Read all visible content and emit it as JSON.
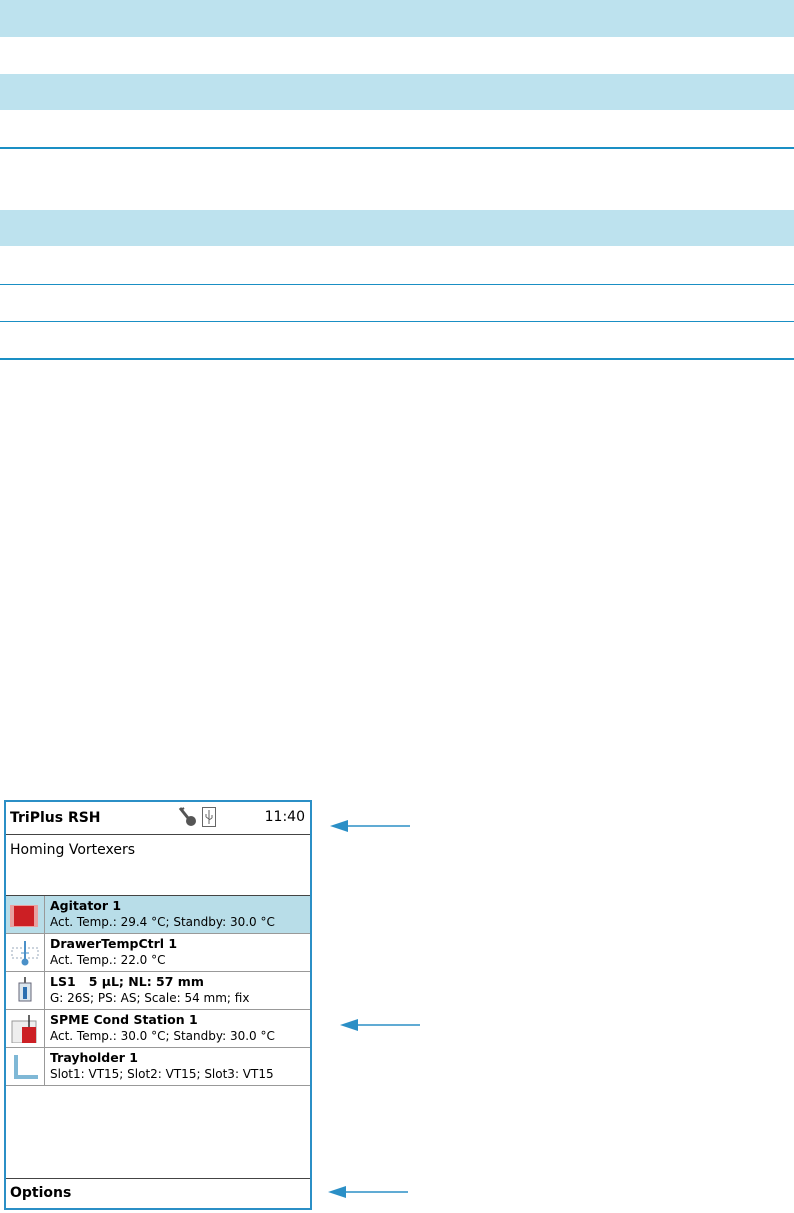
{
  "device": {
    "title": "TriPlus RSH",
    "time": "11:40",
    "status_message": "Homing Vortexers",
    "modules": [
      {
        "name": "Agitator 1",
        "detail": "Act. Temp.: 29.4 °C; Standby: 30.0 °C",
        "selected": true,
        "icon": "agitator-icon"
      },
      {
        "name": "DrawerTempCtrl 1",
        "detail": "Act. Temp.: 22.0 °C",
        "selected": false,
        "icon": "thermometer-icon"
      },
      {
        "name": "LS1   5 µL; NL: 57 mm",
        "detail": "G: 26S; PS: AS; Scale: 54 mm; fix",
        "selected": false,
        "icon": "syringe-icon"
      },
      {
        "name": "SPME Cond Station 1",
        "detail": "Act. Temp.: 30.0 °C; Standby: 30.0 °C",
        "selected": false,
        "icon": "spme-station-icon"
      },
      {
        "name": "Trayholder 1",
        "detail": "Slot1: VT15; Slot2: VT15; Slot3: VT15",
        "selected": false,
        "icon": "trayholder-icon"
      }
    ],
    "options_label": "Options",
    "icons": [
      "key-icon",
      "usb-icon"
    ]
  },
  "colors": {
    "accent": "#2b8fc6",
    "table_band": "#bde2ee",
    "selected_row": "#b8dde8",
    "agitator_red": "#cc1f24"
  }
}
